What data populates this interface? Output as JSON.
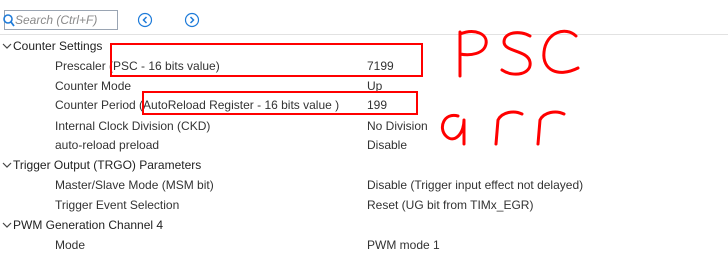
{
  "search": {
    "placeholder": "Search (Ctrl+F)"
  },
  "icons": {
    "search": "magnifier-icon",
    "back": "circle-arrow-left-icon",
    "forward": "circle-arrow-right-icon",
    "expanded": "chevron-down-icon"
  },
  "colors": {
    "accent": "#1e7bd9",
    "highlight": "#ff0000",
    "text": "#333333"
  },
  "sections": [
    {
      "title": "Counter Settings",
      "params": [
        {
          "label": "Prescaler (PSC - 16 bits value)",
          "value": "7199"
        },
        {
          "label": "Counter Mode",
          "value": "Up"
        },
        {
          "label": "Counter Period (AutoReload Register - 16 bits value )",
          "value": "199"
        },
        {
          "label": "Internal Clock Division (CKD)",
          "value": "No Division"
        },
        {
          "label": "auto-reload preload",
          "value": "Disable"
        }
      ]
    },
    {
      "title": "Trigger Output (TRGO) Parameters",
      "params": [
        {
          "label": "Master/Slave Mode (MSM bit)",
          "value": "Disable (Trigger input effect not delayed)"
        },
        {
          "label": "Trigger Event Selection",
          "value": "Reset (UG bit from TIMx_EGR)"
        }
      ]
    },
    {
      "title": "PWM Generation Channel 4",
      "params": [
        {
          "label": "Mode",
          "value": "PWM mode 1"
        }
      ]
    }
  ],
  "annotations": {
    "handwriting": [
      "PSC",
      "arr"
    ]
  }
}
